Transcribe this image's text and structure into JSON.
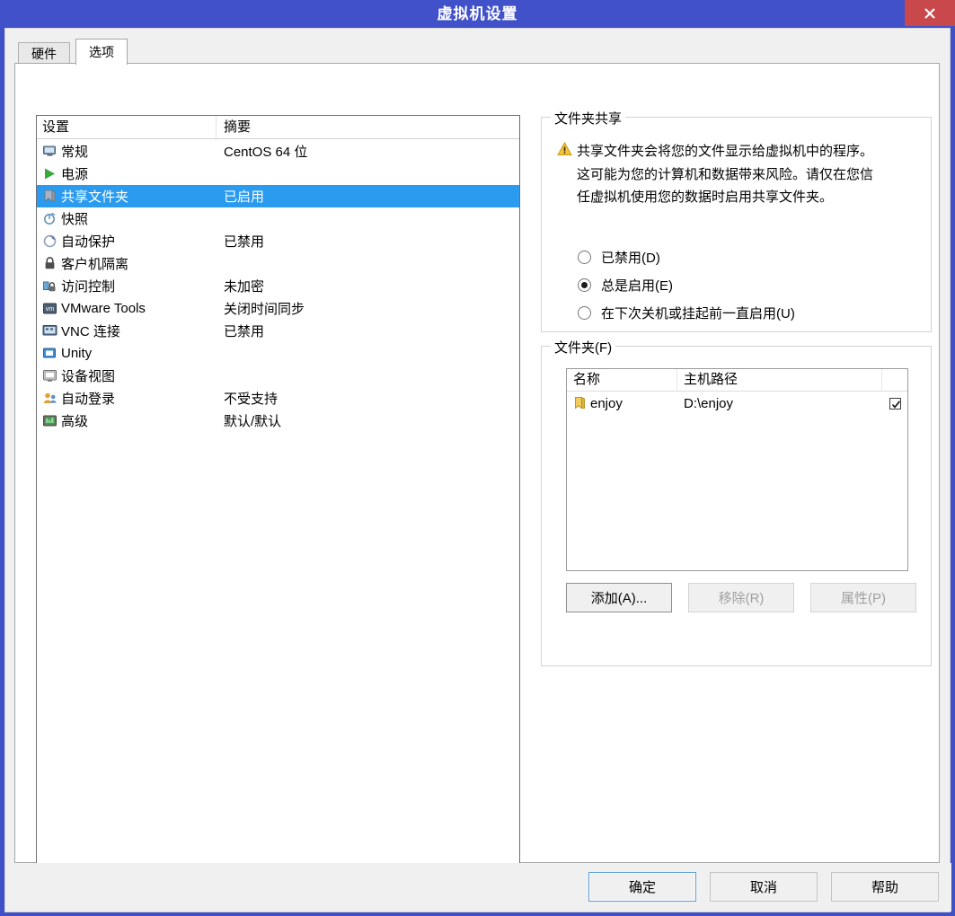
{
  "window": {
    "title": "虚拟机设置",
    "close_icon": "close-icon",
    "titlebar_color": "#4151c9",
    "close_color": "#c8484c"
  },
  "tabs": [
    {
      "label": "硬件",
      "active": false
    },
    {
      "label": "选项",
      "active": true
    }
  ],
  "settings_list": {
    "columns": [
      "设置",
      "摘要"
    ],
    "selection_color": "#2b9bef",
    "rows": [
      {
        "icon": "monitor-icon",
        "name": "常规",
        "summary": "CentOS 64 位",
        "selected": false
      },
      {
        "icon": "power-play-icon",
        "name": "电源",
        "summary": "",
        "selected": false
      },
      {
        "icon": "shared-folder-icon",
        "name": "共享文件夹",
        "summary": "已启用",
        "selected": true
      },
      {
        "icon": "snapshot-icon",
        "name": "快照",
        "summary": "",
        "selected": false
      },
      {
        "icon": "autoprotect-icon",
        "name": "自动保护",
        "summary": "已禁用",
        "selected": false
      },
      {
        "icon": "lock-icon",
        "name": "客户机隔离",
        "summary": "",
        "selected": false
      },
      {
        "icon": "access-control-icon",
        "name": "访问控制",
        "summary": "未加密",
        "selected": false
      },
      {
        "icon": "vmware-tools-icon",
        "name": "VMware Tools",
        "summary": "关闭时间同步",
        "selected": false
      },
      {
        "icon": "vnc-icon",
        "name": "VNC 连接",
        "summary": "已禁用",
        "selected": false
      },
      {
        "icon": "unity-icon",
        "name": "Unity",
        "summary": "",
        "selected": false
      },
      {
        "icon": "device-view-icon",
        "name": "设备视图",
        "summary": "",
        "selected": false
      },
      {
        "icon": "auto-login-icon",
        "name": "自动登录",
        "summary": "不受支持",
        "selected": false
      },
      {
        "icon": "advanced-icon",
        "name": "高级",
        "summary": "默认/默认",
        "selected": false
      }
    ]
  },
  "folder_sharing": {
    "title": "文件夹共享",
    "warning_icon": "warning-icon",
    "warning_color": "#ebb000",
    "warning_text": "共享文件夹会将您的文件显示给虚拟机中的程序。这可能为您的计算机和数据带来风险。请仅在您信任虚拟机使用您的数据时启用共享文件夹。",
    "options": [
      {
        "label": "已禁用(D)",
        "selected": false
      },
      {
        "label": "总是启用(E)",
        "selected": true
      },
      {
        "label": "在下次关机或挂起前一直启用(U)",
        "selected": false
      }
    ]
  },
  "folders": {
    "title": "文件夹(F)",
    "columns": [
      "名称",
      "主机路径",
      ""
    ],
    "rows": [
      {
        "icon": "folder-icon",
        "name": "enjoy",
        "host_path": "D:\\enjoy",
        "enabled": true
      }
    ],
    "buttons": [
      {
        "id": "btn-add",
        "label": "添加(A)...",
        "disabled": false
      },
      {
        "id": "btn-remove",
        "label": "移除(R)",
        "disabled": true
      },
      {
        "id": "btn-props",
        "label": "属性(P)",
        "disabled": true
      }
    ]
  },
  "footer": {
    "ok": "确定",
    "cancel": "取消",
    "help": "帮助"
  }
}
